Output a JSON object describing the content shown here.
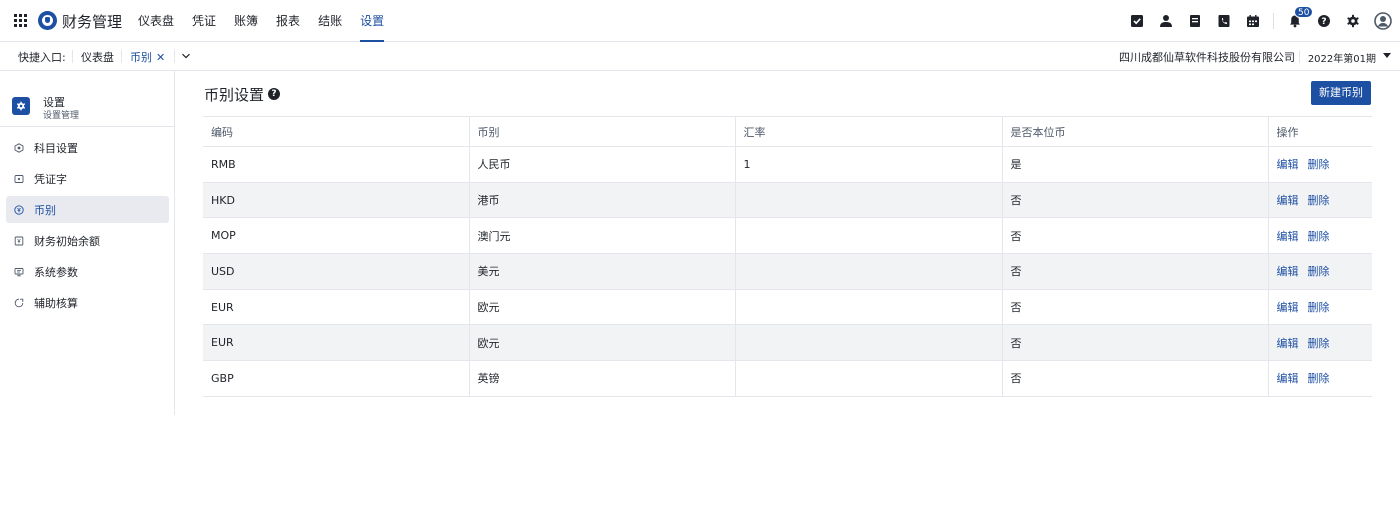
{
  "app": {
    "title": "财务管理",
    "nav": [
      {
        "label": "仪表盘",
        "active": false
      },
      {
        "label": "凭证",
        "active": false
      },
      {
        "label": "账簿",
        "active": false
      },
      {
        "label": "报表",
        "active": false
      },
      {
        "label": "结账",
        "active": false
      },
      {
        "label": "设置",
        "active": true
      }
    ],
    "notification_count": "50",
    "tools": [
      "check-square-icon",
      "user-icon",
      "document-icon",
      "phone-book-icon",
      "calendar-icon",
      "bell-icon",
      "help-icon",
      "gear-icon",
      "avatar-icon"
    ]
  },
  "quickbar": {
    "label": "快捷入口:",
    "tabs": [
      {
        "label": "仪表盘",
        "active": false,
        "closable": false
      },
      {
        "label": "币别",
        "active": true,
        "closable": true,
        "close_glyph": "✕"
      }
    ],
    "company": "四川成都仙草软件科技股份有限公司",
    "period": "2022年第01期"
  },
  "sidebar": {
    "title": "设置",
    "subtitle": "设置管理",
    "items": [
      {
        "label": "科目设置",
        "icon": "subject-icon",
        "active": false
      },
      {
        "label": "凭证字",
        "icon": "voucher-icon",
        "active": false
      },
      {
        "label": "币别",
        "icon": "currency-icon",
        "active": true
      },
      {
        "label": "财务初始余额",
        "icon": "balance-icon",
        "active": false
      },
      {
        "label": "系统参数",
        "icon": "monitor-icon",
        "active": false
      },
      {
        "label": "辅助核算",
        "icon": "auxiliary-icon",
        "active": false
      }
    ]
  },
  "main": {
    "title": "币别设置",
    "new_button": "新建币别",
    "columns": [
      "编码",
      "币别",
      "汇率",
      "是否本位币",
      "操作"
    ],
    "rows": [
      {
        "code": "RMB",
        "currency": "人民币",
        "rate": "1",
        "is_base": "是"
      },
      {
        "code": "HKD",
        "currency": "港币",
        "rate": "",
        "is_base": "否"
      },
      {
        "code": "MOP",
        "currency": "澳门元",
        "rate": "",
        "is_base": "否"
      },
      {
        "code": "USD",
        "currency": "美元",
        "rate": "",
        "is_base": "否"
      },
      {
        "code": "EUR",
        "currency": "欧元",
        "rate": "",
        "is_base": "否"
      },
      {
        "code": "EUR",
        "currency": "欧元",
        "rate": "",
        "is_base": "否"
      },
      {
        "code": "GBP",
        "currency": "英镑",
        "rate": "",
        "is_base": "否"
      }
    ],
    "actions": {
      "edit": "编辑",
      "delete": "删除"
    }
  },
  "colors": {
    "accent": "#1d4fa3",
    "border": "#e5e6eb",
    "stripe": "#f2f3f5"
  }
}
